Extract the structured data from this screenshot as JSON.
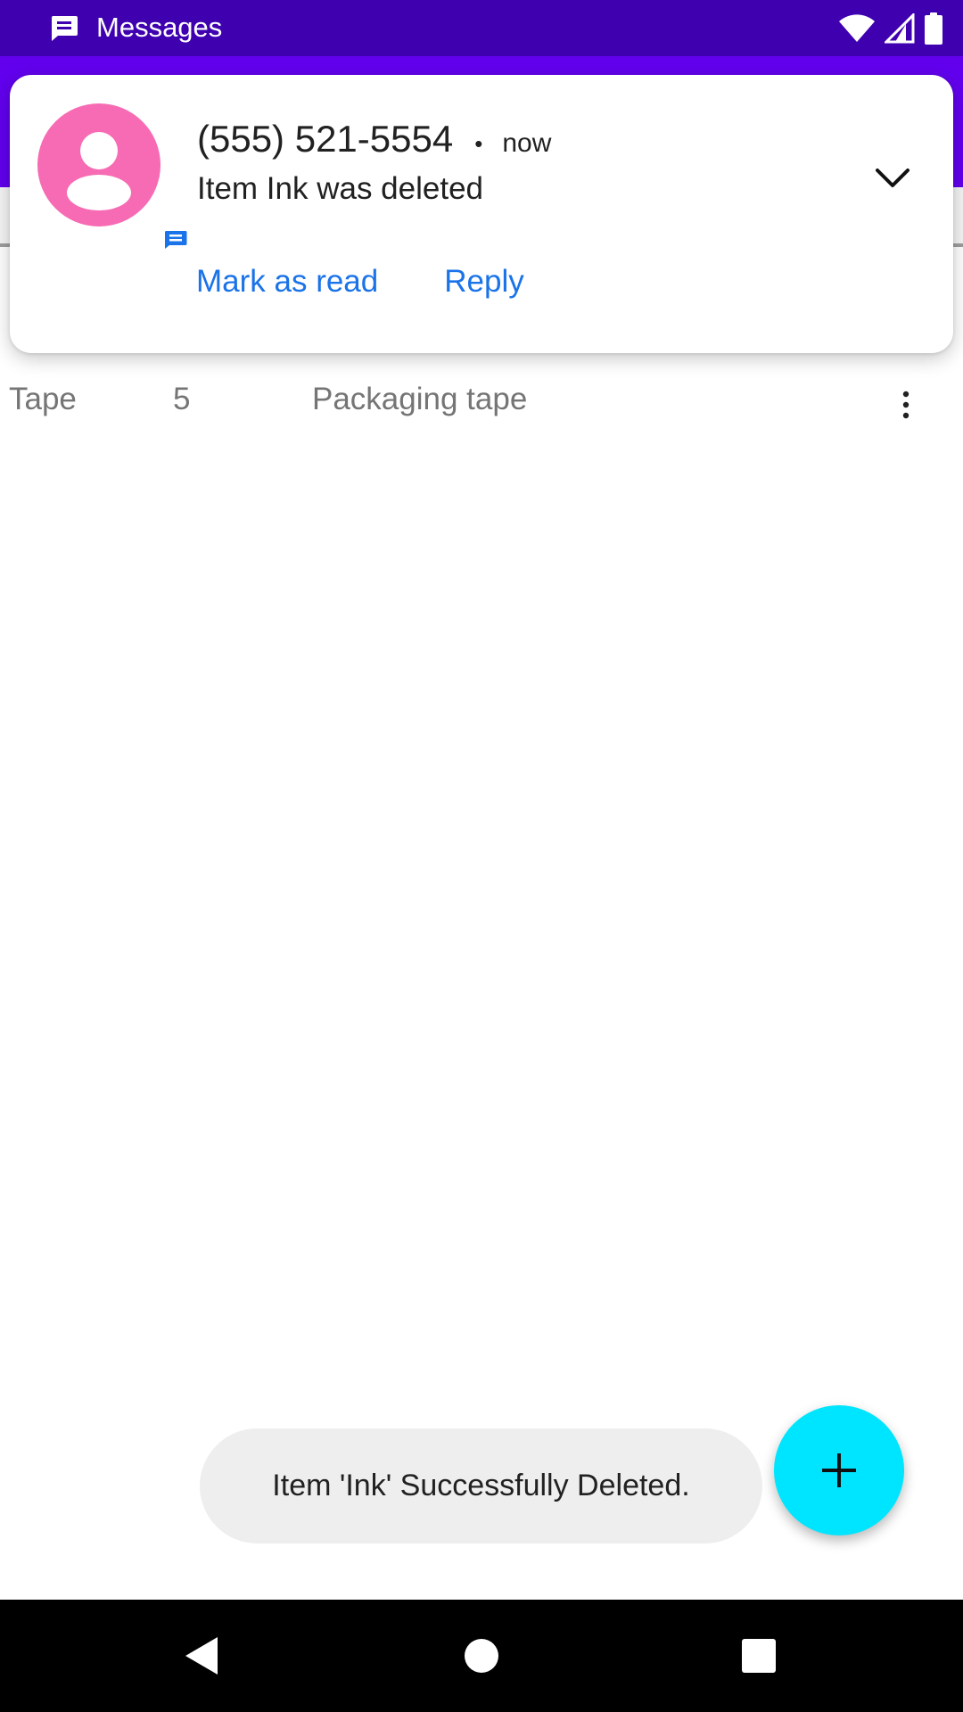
{
  "status_bar": {
    "app_label": "Messages",
    "icons": [
      "messages-icon",
      "wifi-icon",
      "cell-signal-icon",
      "battery-icon"
    ]
  },
  "notification": {
    "sender": "(555) 521-5554",
    "separator": "•",
    "time": "now",
    "body": "Item Ink was deleted",
    "actions": {
      "mark_read": "Mark as read",
      "reply": "Reply"
    },
    "avatar_color": "#f76bb4",
    "accent_color": "#1a73e8"
  },
  "list": {
    "rows": [
      {
        "name": "Tape",
        "quantity": "5",
        "description": "Packaging tape"
      }
    ]
  },
  "toast": {
    "message": "Item 'Ink' Successfully Deleted."
  },
  "fab": {
    "icon": "plus-icon",
    "color": "#00e5ff"
  },
  "colors": {
    "status_bar": "#3f00b0",
    "app_bar": "#6200ee"
  }
}
